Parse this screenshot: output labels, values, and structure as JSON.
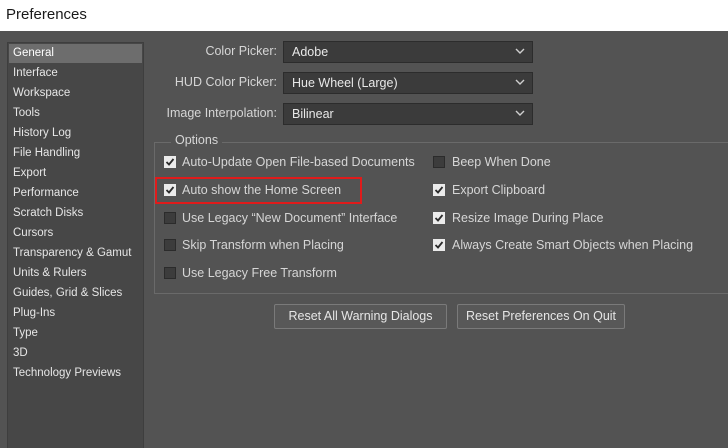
{
  "window": {
    "title": "Preferences"
  },
  "sidebar": {
    "items": [
      {
        "label": "General",
        "selected": true
      },
      {
        "label": "Interface"
      },
      {
        "label": "Workspace"
      },
      {
        "label": "Tools"
      },
      {
        "label": "History Log"
      },
      {
        "label": "File Handling"
      },
      {
        "label": "Export"
      },
      {
        "label": "Performance"
      },
      {
        "label": "Scratch Disks"
      },
      {
        "label": "Cursors"
      },
      {
        "label": "Transparency & Gamut"
      },
      {
        "label": "Units & Rulers"
      },
      {
        "label": "Guides, Grid & Slices"
      },
      {
        "label": "Plug-Ins"
      },
      {
        "label": "Type"
      },
      {
        "label": "3D"
      },
      {
        "label": "Technology Previews"
      }
    ]
  },
  "general": {
    "color_picker": {
      "label": "Color Picker:",
      "value": "Adobe"
    },
    "hud_color_picker": {
      "label": "HUD Color Picker:",
      "value": "Hue Wheel (Large)"
    },
    "image_interpolation": {
      "label": "Image Interpolation:",
      "value": "Bilinear"
    }
  },
  "options": {
    "title": "Options",
    "items": [
      {
        "label": "Auto-Update Open File-based Documents",
        "checked": true
      },
      {
        "label": "Auto show the Home Screen",
        "checked": true
      },
      {
        "label": "Use Legacy “New Document” Interface",
        "checked": false
      },
      {
        "label": "Skip Transform when Placing",
        "checked": false
      },
      {
        "label": "Use Legacy Free Transform",
        "checked": false
      },
      {
        "label": "Beep When Done",
        "checked": false
      },
      {
        "label": "Export Clipboard",
        "checked": true
      },
      {
        "label": "Resize Image During Place",
        "checked": true
      },
      {
        "label": "Always Create Smart Objects when Placing",
        "checked": true
      }
    ]
  },
  "buttons": {
    "reset_warnings": "Reset All Warning Dialogs",
    "reset_prefs": "Reset Preferences On Quit"
  },
  "colors": {
    "background": "#535353",
    "highlight": "#e01b1b",
    "selected_item": "#6d6d6d"
  }
}
